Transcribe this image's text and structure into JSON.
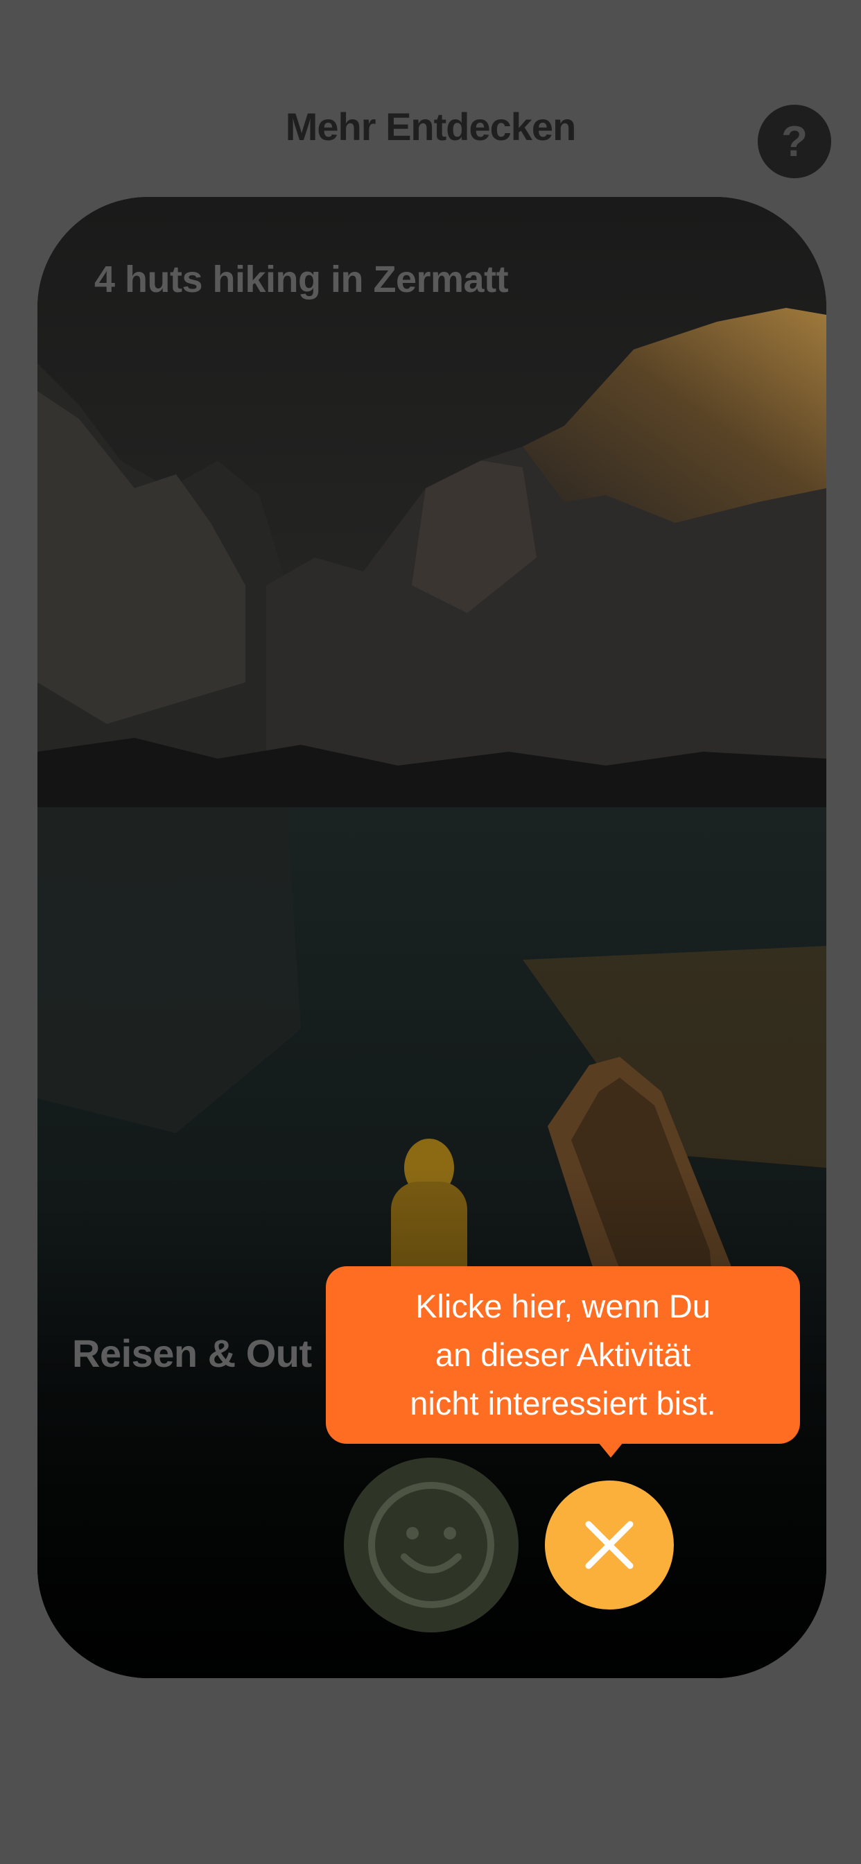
{
  "header": {
    "title": "Mehr Entdecken",
    "help_label": "?"
  },
  "card": {
    "title": "4 huts hiking in Zermatt",
    "category": "Reisen & Out"
  },
  "tooltip": {
    "lines": [
      "Klicke hier, wenn Du",
      "an dieser Aktivität",
      "nicht interessiert bist."
    ]
  },
  "icons": {
    "help": "question-mark-icon",
    "like": "smiley-icon",
    "dislike": "close-icon"
  },
  "colors": {
    "background": "#505050",
    "tooltip": "#ff6d22",
    "dislike_button": "#fbb03b",
    "like_button": "#2e3426"
  }
}
